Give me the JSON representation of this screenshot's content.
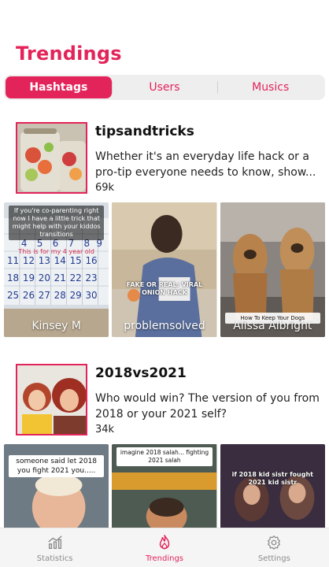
{
  "header": {
    "title": "Trendings"
  },
  "segments": [
    {
      "label": "Hashtags",
      "active": true
    },
    {
      "label": "Users",
      "active": false
    },
    {
      "label": "Musics",
      "active": false
    }
  ],
  "hashtags": [
    {
      "title": "tipsandtricks",
      "description": "Whether it's an everyday life hack or a pro-tip everyone needs to know, show...",
      "count": "69k",
      "videos": [
        {
          "author": "Kinsey M",
          "overlay": "If you're co-parenting right now I have a little trick that might help with your kiddos transitions",
          "caption": "This is for my 4 year old"
        },
        {
          "author": "problemsolved",
          "overlay": "FAKE OR REAL: VIRAL ONION HACK"
        },
        {
          "author": "Alissa Albright",
          "overlay": "How To Keep Your Dogs"
        }
      ]
    },
    {
      "title": "2018vs2021",
      "description": "Who would win? The version of you from 2018 or your 2021 self?",
      "count": "34k",
      "videos": [
        {
          "author": "",
          "overlay": "someone said let 2018 you fight 2021 you....."
        },
        {
          "author": "",
          "overlay": "imagine 2018 salah... fighting 2021 salah"
        },
        {
          "author": "",
          "overlay": "if 2018 kid sistr fought 2021 kid sistr"
        }
      ]
    }
  ],
  "tabbar": [
    {
      "label": "Statistics",
      "icon": "chart-icon",
      "active": false
    },
    {
      "label": "Trendings",
      "icon": "flame-icon",
      "active": true
    },
    {
      "label": "Settings",
      "icon": "gear-icon",
      "active": false
    }
  ],
  "colors": {
    "accent": "#e3245a",
    "inactive": "#8b8b8b"
  }
}
